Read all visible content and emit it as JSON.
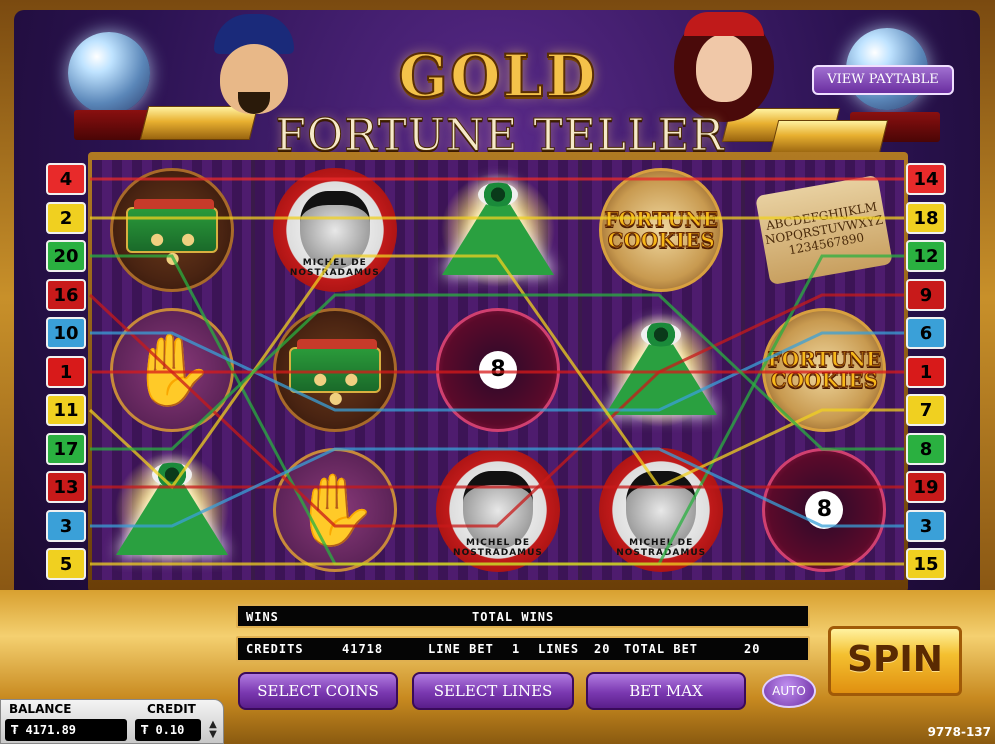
{
  "header": {
    "title_gold": "GOLD",
    "title_fortune_teller": "FORTUNE TELLER",
    "paytable_label": "VIEW PAYTABLE"
  },
  "paylines": {
    "left": [
      "4",
      "2",
      "20",
      "16",
      "10",
      "1",
      "11",
      "17",
      "13",
      "3",
      "5"
    ],
    "right": [
      "14",
      "18",
      "12",
      "9",
      "6",
      "1",
      "7",
      "8",
      "19",
      "3",
      "15"
    ],
    "colors_left": [
      "#e82a2a",
      "#f0d020",
      "#2ab040",
      "#c81a1a",
      "#3aa0d8",
      "#d81a1a",
      "#f0d020",
      "#2ab040",
      "#c81a1a",
      "#3aa0d8",
      "#f0d020"
    ],
    "colors_right": [
      "#e82a2a",
      "#f0d020",
      "#2ab040",
      "#c81a1a",
      "#3aa0d8",
      "#d81a1a",
      "#f0d020",
      "#2ab040",
      "#c81a1a",
      "#3aa0d8",
      "#f0d020"
    ]
  },
  "reels": {
    "nostradamus_label": "MICHEL DE NOSTRADAMUS",
    "cookie_label_1": "FORTUNE",
    "cookie_label_2": "COOKIES",
    "ball_number": "8"
  },
  "meters": {
    "wins_label": "WINS",
    "total_wins_label": "TOTAL WINS",
    "credits_label": "CREDITS",
    "credits_value": "41718",
    "line_bet_label": "LINE BET",
    "line_bet_value": "1",
    "lines_label": "LINES",
    "lines_value": "20",
    "total_bet_label": "TOTAL BET",
    "total_bet_value": "20"
  },
  "controls": {
    "select_coins": "SELECT COINS",
    "select_lines": "SELECT LINES",
    "bet_max": "BET MAX",
    "auto": "AUTO",
    "spin": "SPIN"
  },
  "account": {
    "balance_label": "BALANCE",
    "balance_value": "₮ 4171.89",
    "credit_label": "CREDIT",
    "credit_value": "₮ 0.10"
  },
  "game_id": "9778-137"
}
